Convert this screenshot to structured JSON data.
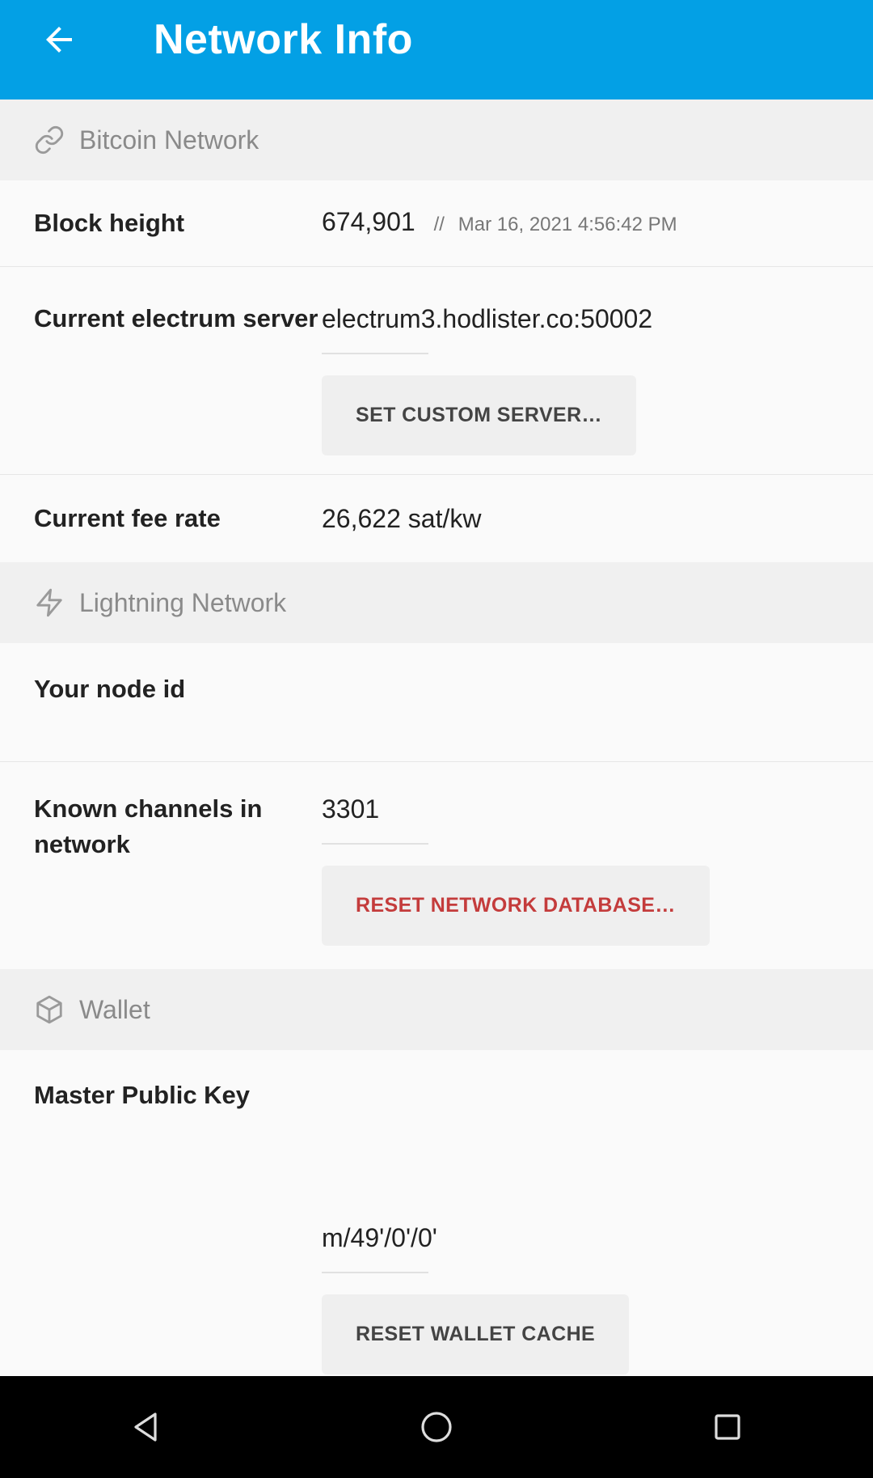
{
  "appbar": {
    "title": "Network Info"
  },
  "bitcoin": {
    "header": "Bitcoin Network",
    "block_height_label": "Block height",
    "block_height_value": "674,901",
    "block_height_sep": "//",
    "block_height_time": "Mar 16, 2021 4:56:42 PM",
    "server_label": "Current electrum server",
    "server_value": "electrum3.hodlister.co:50002",
    "set_server_button": "SET CUSTOM SERVER…",
    "fee_label": "Current fee rate",
    "fee_value": "26,622 sat/kw"
  },
  "lightning": {
    "header": "Lightning Network",
    "node_id_label": "Your node id",
    "channels_label": "Known channels in network",
    "channels_value": "3301",
    "reset_db_button": "RESET NETWORK DATABASE…"
  },
  "wallet": {
    "header": "Wallet",
    "mpk_label": "Master Public Key",
    "derivation_path": "m/49'/0'/0'",
    "reset_cache_button": "RESET WALLET CACHE"
  },
  "colors": {
    "appbar": "#03a0e5",
    "danger": "#c43c3c"
  },
  "icons": [
    "back-arrow-icon",
    "link-icon",
    "lightning-icon",
    "cube-icon",
    "nav-back-icon",
    "nav-home-icon",
    "nav-recents-icon"
  ]
}
